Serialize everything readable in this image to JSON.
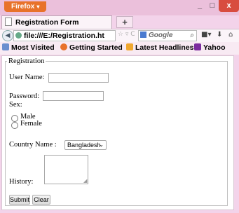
{
  "browser": {
    "menu_label": "Firefox",
    "menu_arrow": "▾",
    "window_controls": {
      "minimize": "_",
      "maximize": "□",
      "close": "x"
    },
    "tab_title": "Registration Form",
    "new_tab_label": "+",
    "url": "file:///E:/Registration.ht",
    "url_icons": "☆ ▿ C",
    "search_engine": "Google",
    "search_icon": "⌕",
    "toolbar_icons": {
      "bookmarks_menu": "■▾",
      "downloads": "⬇",
      "home": "⌂"
    },
    "bookmarks": [
      "Most Visited",
      "Getting Started",
      "Latest Headlines",
      "Yahoo"
    ],
    "colors": {
      "firefox_orange": "#e8722a",
      "close_red": "#d84c3f",
      "title_bg": "#ebc0db"
    }
  },
  "form": {
    "legend": "Registration",
    "username_label": "User Name:",
    "username_value": "",
    "password_label": "Password:",
    "password_value": "",
    "sex_label": "Sex:",
    "sex_options": [
      "Male",
      "Female"
    ],
    "country_label": "Country Name :",
    "country_selected": "Bangladesh",
    "history_label": "History:",
    "history_value": "",
    "submit_label": "Submit",
    "clear_label": "Clear"
  }
}
